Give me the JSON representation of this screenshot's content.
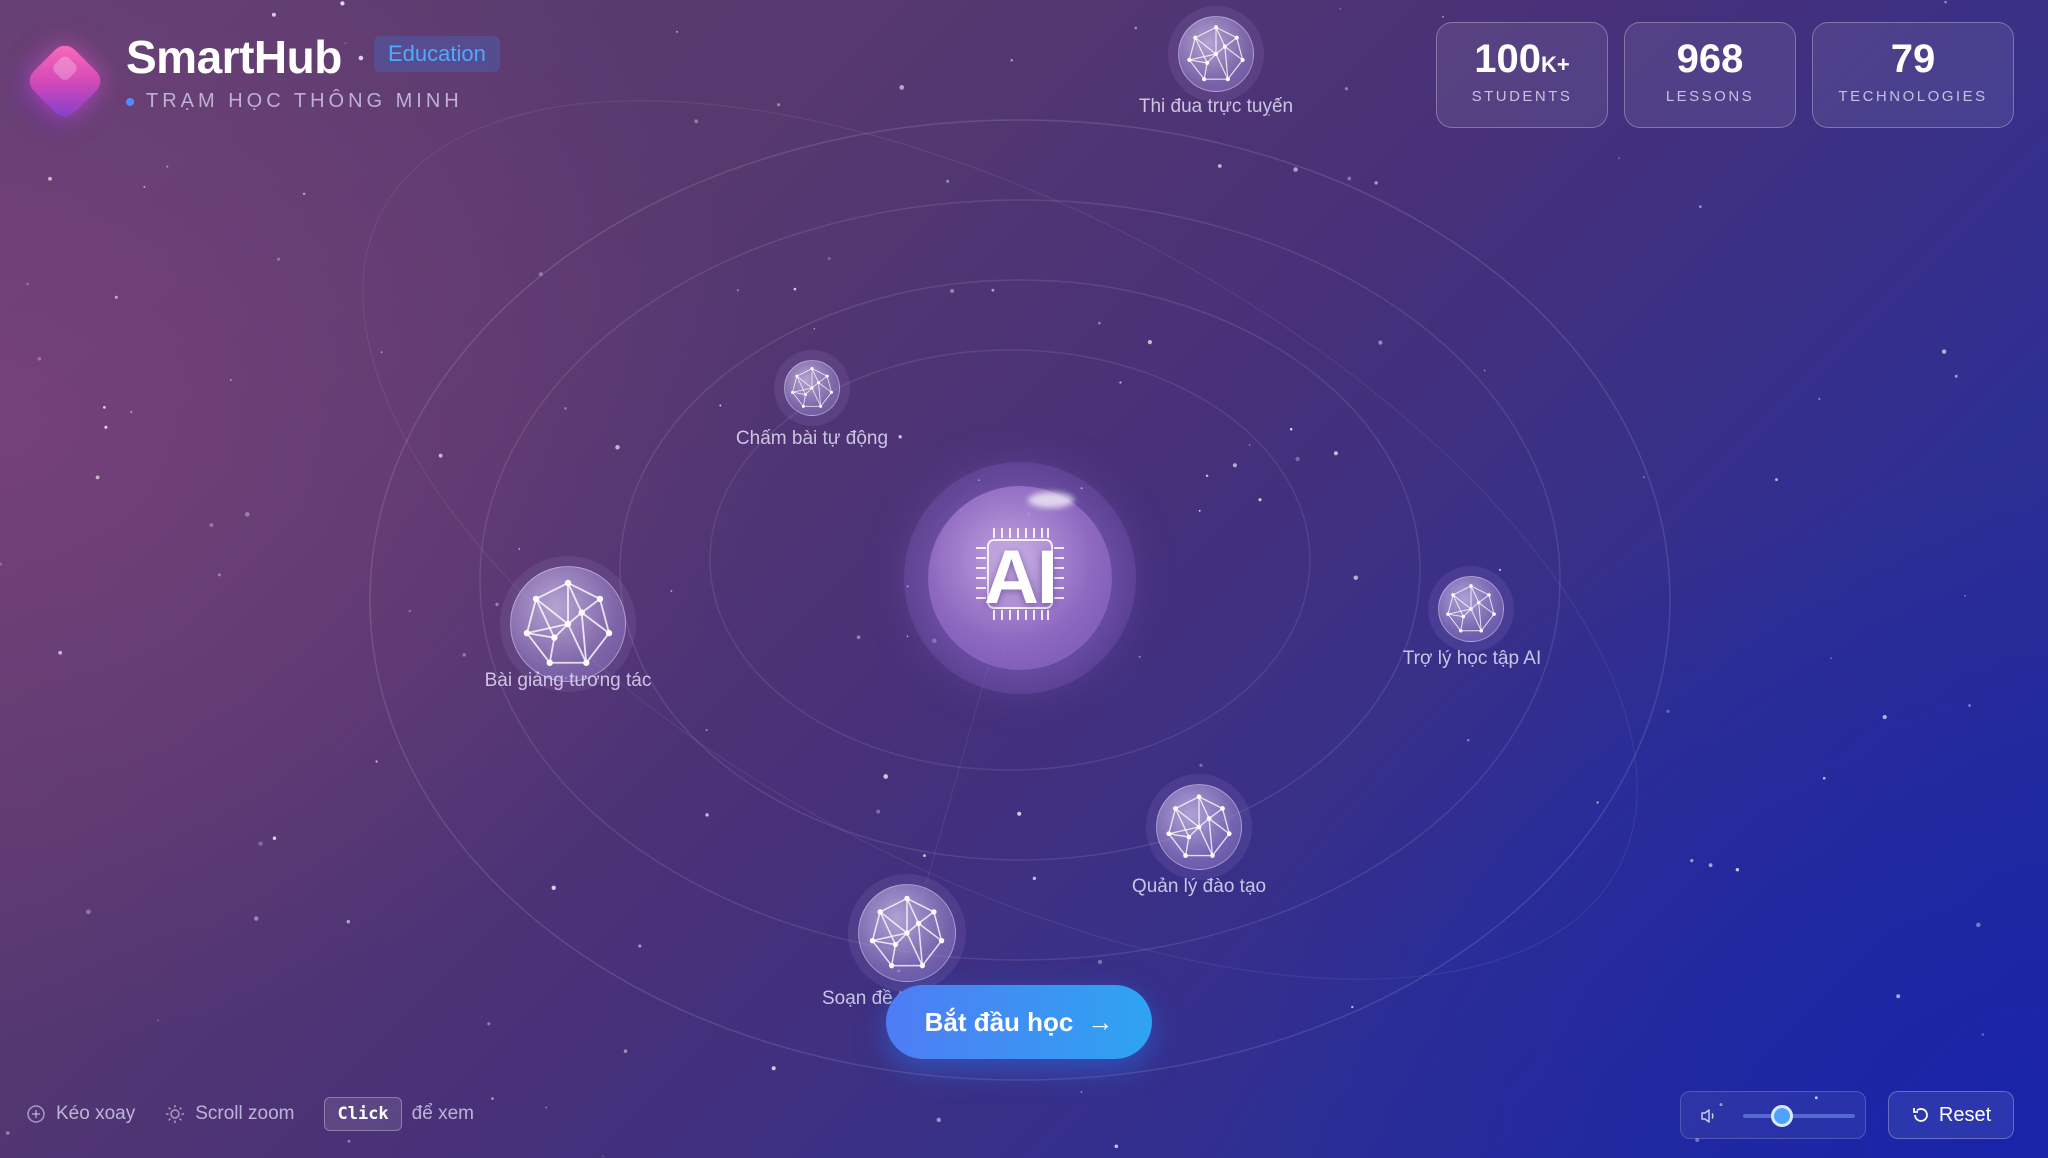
{
  "brand": {
    "title": "SmartHub",
    "badge": "Education",
    "subtitle": "TRẠM HỌC THÔNG MINH"
  },
  "stats": [
    {
      "value": "100",
      "suffix": "K+",
      "label": "STUDENTS"
    },
    {
      "value": "968",
      "suffix": "",
      "label": "LESSONS"
    },
    {
      "value": "79",
      "suffix": "",
      "label": "TECHNOLOGIES"
    }
  ],
  "core": {
    "label": "AI"
  },
  "nodes": [
    {
      "label": "Thi đua trực tuyến",
      "icon": "network-icon"
    },
    {
      "label": "Chấm bài tự động",
      "icon": "network-icon"
    },
    {
      "label": "Bài giảng tương tác",
      "icon": "network-icon"
    },
    {
      "label": "Trợ lý học tập AI",
      "icon": "network-icon"
    },
    {
      "label": "Quản lý đào tạo",
      "icon": "network-icon"
    },
    {
      "label": "Soạn đề thông minh",
      "icon": "network-icon"
    }
  ],
  "cta": {
    "label": "Bắt đầu học",
    "icon": "arrow-right-icon"
  },
  "hints": {
    "drag": "Kéo xoay",
    "zoom": "Scroll zoom",
    "click_key": "Click",
    "click_text": "để xem"
  },
  "controls": {
    "volume_level": 0.35,
    "reset_label": "Reset"
  },
  "colors": {
    "accent": "#4fa8ff",
    "cta_start": "#4f7cf5",
    "cta_end": "#2ea4f2",
    "logo": "#d44ab8"
  }
}
